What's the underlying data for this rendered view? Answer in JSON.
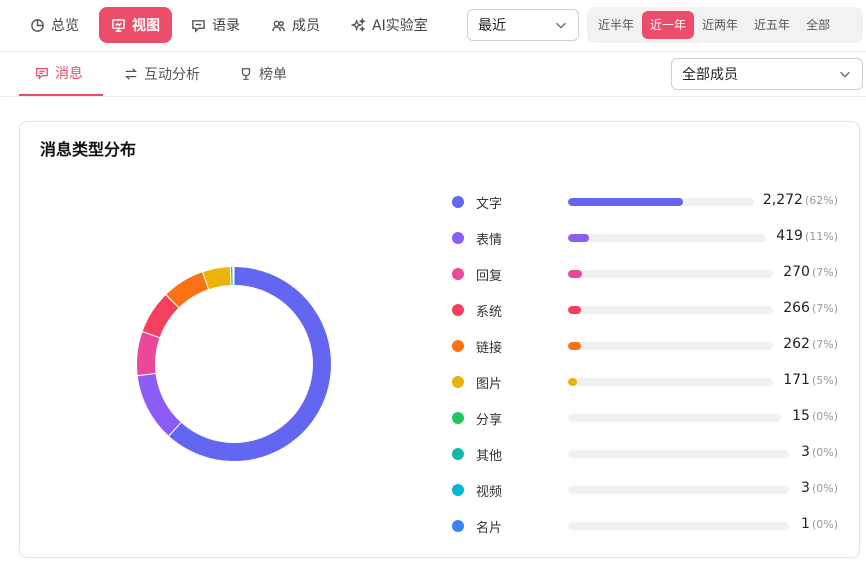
{
  "nav": {
    "items": [
      {
        "label": "总览",
        "icon": "overview-icon"
      },
      {
        "label": "视图",
        "icon": "chart-view-icon",
        "active": true
      },
      {
        "label": "语录",
        "icon": "quote-icon"
      },
      {
        "label": "成员",
        "icon": "members-icon"
      },
      {
        "label": "AI实验室",
        "icon": "sparkle-icon"
      }
    ]
  },
  "period_select": {
    "value": "最近"
  },
  "ranges": [
    {
      "label": "近半年"
    },
    {
      "label": "近一年",
      "active": true
    },
    {
      "label": "近两年"
    },
    {
      "label": "近五年"
    },
    {
      "label": "全部"
    }
  ],
  "subtabs": [
    {
      "label": "消息",
      "icon": "message-icon",
      "active": true
    },
    {
      "label": "互动分析",
      "icon": "swap-icon"
    },
    {
      "label": "榜单",
      "icon": "trophy-icon"
    }
  ],
  "member_select": {
    "value": "全部成员"
  },
  "card": {
    "title": "消息类型分布"
  },
  "colors": {
    "accent": "#ec4d6a"
  },
  "chart_data": {
    "type": "pie",
    "title": "消息类型分布",
    "categories": [
      "文字",
      "表情",
      "回复",
      "系统",
      "链接",
      "图片",
      "分享",
      "其他",
      "视频",
      "名片"
    ],
    "values": [
      2272,
      419,
      270,
      266,
      262,
      171,
      15,
      3,
      3,
      1
    ],
    "value_labels": [
      "2,272",
      "419",
      "270",
      "266",
      "262",
      "171",
      "15",
      "3",
      "3",
      "1"
    ],
    "percent_labels": [
      "(62%)",
      "(11%)",
      "(7%)",
      "(7%)",
      "(7%)",
      "(5%)",
      "(0%)",
      "(0%)",
      "(0%)",
      "(0%)"
    ],
    "colors": [
      "#6366f1",
      "#8b5cf6",
      "#ec4899",
      "#f43f5e",
      "#f97316",
      "#eab308",
      "#22c55e",
      "#14b8a6",
      "#06b6d4",
      "#3b82f6"
    ]
  }
}
